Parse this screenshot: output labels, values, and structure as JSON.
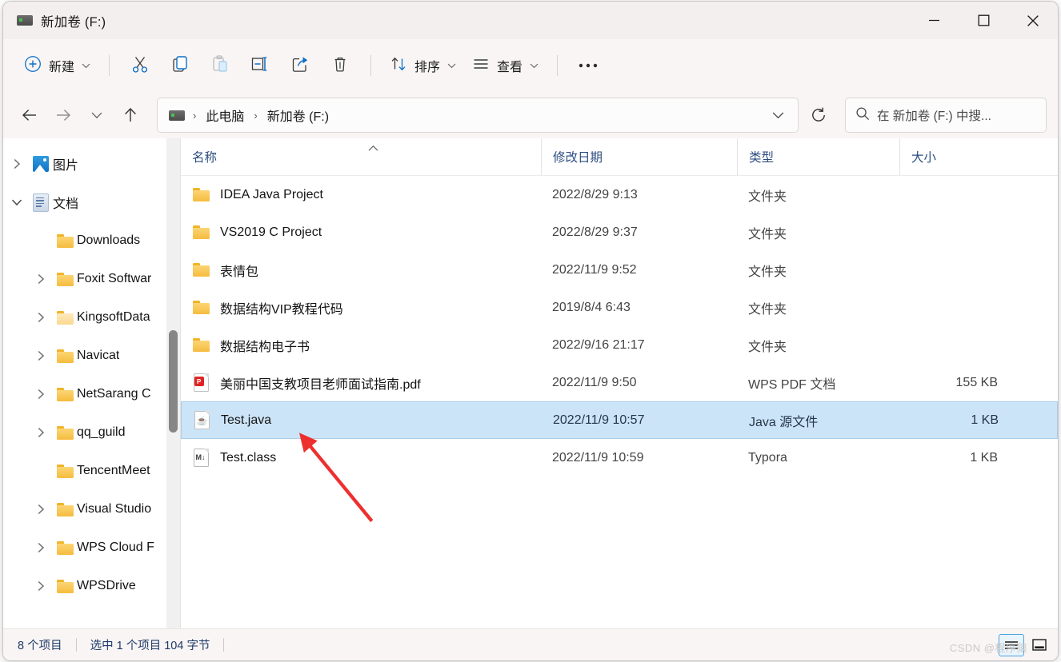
{
  "window": {
    "title": "新加卷 (F:)",
    "controls": {
      "minimize": "最小化",
      "maximize": "最大化",
      "close": "关闭"
    }
  },
  "toolbar": {
    "new_label": "新建",
    "cut_label": "剪切",
    "copy_label": "复制",
    "paste_label": "粘贴",
    "rename_label": "重命名",
    "share_label": "共享",
    "delete_label": "删除",
    "sort_label": "排序",
    "view_label": "查看",
    "more_label": "查看更多"
  },
  "navigation": {
    "back": "后退",
    "forward": "前进",
    "recent": "最近的位置",
    "up": "上移到上一级"
  },
  "address": {
    "crumbs": [
      "此电脑",
      "新加卷 (F:)"
    ],
    "separator": "›",
    "dropdown": "历史记录",
    "refresh": "刷新"
  },
  "search": {
    "placeholder": "在 新加卷 (F:) 中搜..."
  },
  "sidebar": {
    "items": [
      {
        "label": "图片",
        "icon": "picture-icon",
        "indent": 0,
        "chevron": "collapsed"
      },
      {
        "label": "文档",
        "icon": "document-icon",
        "indent": 0,
        "chevron": "expanded"
      },
      {
        "label": "Downloads",
        "icon": "folder-icon",
        "indent": 1,
        "chevron": "none"
      },
      {
        "label": "Foxit Softwar",
        "icon": "folder-icon",
        "indent": 1,
        "chevron": "collapsed"
      },
      {
        "label": "KingsoftData",
        "icon": "folder-pale-icon",
        "indent": 1,
        "chevron": "collapsed"
      },
      {
        "label": "Navicat",
        "icon": "folder-icon",
        "indent": 1,
        "chevron": "collapsed"
      },
      {
        "label": "NetSarang C",
        "icon": "folder-icon",
        "indent": 1,
        "chevron": "collapsed"
      },
      {
        "label": "qq_guild",
        "icon": "folder-icon",
        "indent": 1,
        "chevron": "collapsed"
      },
      {
        "label": "TencentMeet",
        "icon": "folder-icon",
        "indent": 1,
        "chevron": "none"
      },
      {
        "label": "Visual Studio",
        "icon": "folder-icon",
        "indent": 1,
        "chevron": "collapsed"
      },
      {
        "label": "WPS Cloud F",
        "icon": "folder-icon",
        "indent": 1,
        "chevron": "collapsed"
      },
      {
        "label": "WPSDrive",
        "icon": "folder-icon",
        "indent": 1,
        "chevron": "collapsed"
      }
    ]
  },
  "filelist": {
    "columns": [
      {
        "key": "name",
        "label": "名称",
        "sorted": "asc"
      },
      {
        "key": "date",
        "label": "修改日期",
        "sorted": "none"
      },
      {
        "key": "type",
        "label": "类型",
        "sorted": "none"
      },
      {
        "key": "size",
        "label": "大小",
        "sorted": "none"
      }
    ],
    "rows": [
      {
        "name": "IDEA Java Project",
        "date": "2022/8/29 9:13",
        "type": "文件夹",
        "size": "",
        "icon": "folder-icon",
        "selected": false
      },
      {
        "name": "VS2019 C Project",
        "date": "2022/8/29 9:37",
        "type": "文件夹",
        "size": "",
        "icon": "folder-icon",
        "selected": false
      },
      {
        "name": "表情包",
        "date": "2022/11/9 9:52",
        "type": "文件夹",
        "size": "",
        "icon": "folder-icon",
        "selected": false
      },
      {
        "name": "数据结构VIP教程代码",
        "date": "2019/8/4 6:43",
        "type": "文件夹",
        "size": "",
        "icon": "folder-icon",
        "selected": false
      },
      {
        "name": "数据结构电子书",
        "date": "2022/9/16 21:17",
        "type": "文件夹",
        "size": "",
        "icon": "folder-icon",
        "selected": false
      },
      {
        "name": "美丽中国支教项目老师面试指南.pdf",
        "date": "2022/11/9 9:50",
        "type": "WPS PDF 文档",
        "size": "155 KB",
        "icon": "pdf-file-icon",
        "selected": false
      },
      {
        "name": "Test.java",
        "date": "2022/11/9 10:57",
        "type": "Java 源文件",
        "size": "1 KB",
        "icon": "java-file-icon",
        "selected": true
      },
      {
        "name": "Test.class",
        "date": "2022/11/9 10:59",
        "type": "Typora",
        "size": "1 KB",
        "icon": "typora-file-icon",
        "selected": false
      }
    ]
  },
  "statusbar": {
    "item_count": "8 个项目",
    "selection": "选中 1 个项目  104 字节",
    "view_details": "详细信息视图",
    "view_large_icons": "大图标视图"
  },
  "watermark": "CSDN @程序猿",
  "colors": {
    "accent": "#0067c0",
    "selection_bg": "#cce4f7",
    "selection_border": "#a8cdea",
    "column_header_text": "#2c4d80",
    "status_text": "#1f3b66",
    "annotation_arrow": "#ee2f2f",
    "folder_yellow": "#f5bc3e",
    "window_bg": "#f9f5f5"
  }
}
